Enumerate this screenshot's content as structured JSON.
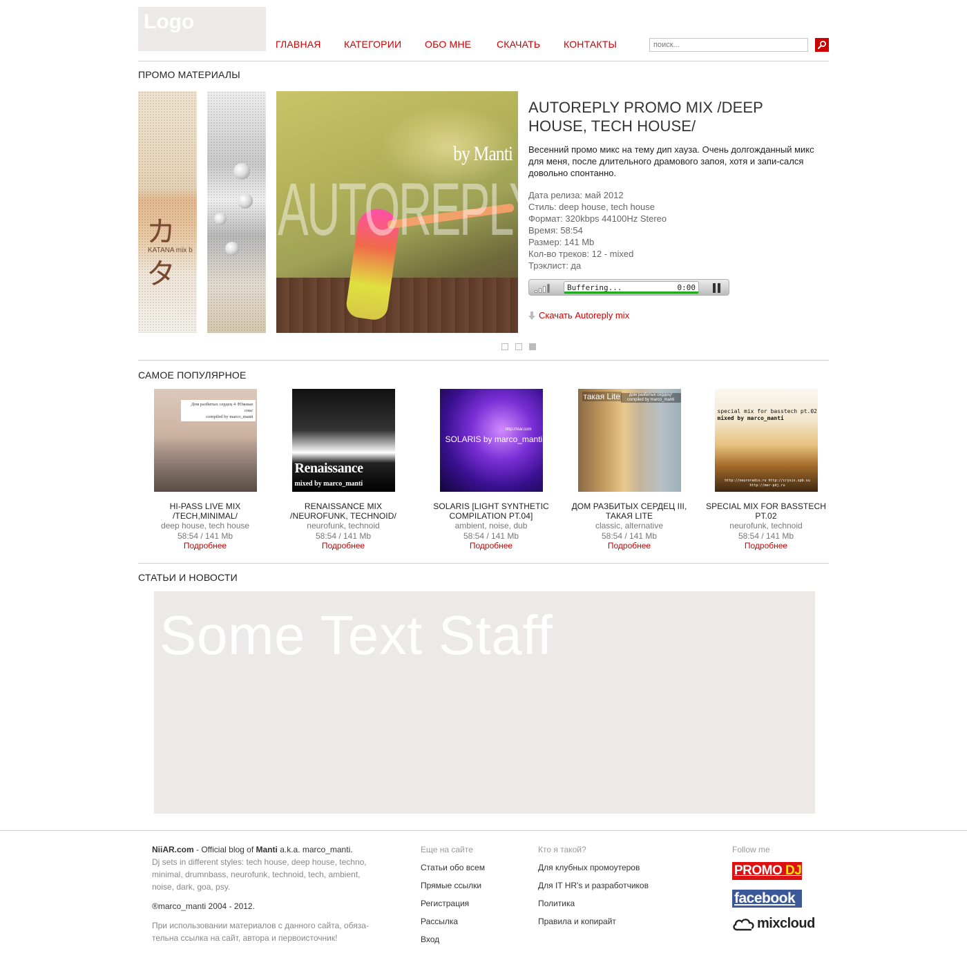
{
  "header": {
    "logo": "Logo",
    "nav": [
      "ГЛАВНАЯ",
      "КАТЕГОРИИ",
      "ОБО МНЕ",
      "СКАЧАТЬ",
      "КОНТАКТЫ"
    ],
    "search_placeholder": "поиск..."
  },
  "promo": {
    "section_title": "ПРОМО МАТЕРИАЛЫ",
    "strip1_kanji": "カタ",
    "strip1_caption": "KATANA mix b",
    "cover_byline": "by Manti",
    "cover_big": "AUTOREPLY",
    "title": "AUTOREPLY PROMO MIX /DEEP HOUSE, TECH HOUSE/",
    "description": "Весенний промо микс на тему дип хауза. Очень долгожданный микс для меня, после длительного драмового запоя, хотя и запи-сался довольно спонтанно.",
    "meta": [
      "Дата релиза: май 2012",
      "Стиль: deep house, tech house",
      "Формат: 320kbps 44100Hz Stereo",
      "Время: 58:54",
      "Размер: 141 Mb",
      "Кол-во треков: 12 - mixed",
      "Трэклист: да"
    ],
    "player": {
      "status": "Buffering...",
      "time": "0:00"
    },
    "download_label": "Скачать Autoreply mix",
    "pager_count": 3,
    "pager_active": 2
  },
  "popular": {
    "section_title": "САМОЕ ПОПУЛЯРНОЕ",
    "more_label": "Подробнее",
    "items": [
      {
        "name": "HI-PASS LIVE MIX /TECH,MINIMAL/",
        "genre": "deep house, tech house",
        "size": "58:54 / 141 Mb",
        "cover_text": [
          "Дом разбитых сердец 4 /Южные сны/",
          "compiled by marco_manti"
        ]
      },
      {
        "name": "RENAISSANCE MIX /NEUROFUNK, TECHNOID/",
        "genre": "neurofunk, technoid",
        "size": "58:54 / 141 Mb",
        "cover_text": [
          "Renaissance",
          "mixed by marco_manti"
        ]
      },
      {
        "name": "SOLARIS [LIGHT SYNTHETIC COMPILATION PT.04]",
        "genre": "ambient, noise, dub",
        "size": "58:54 / 141 Mb",
        "cover_text": [
          "SOLARIS by marco_manti",
          "http://niar.com"
        ]
      },
      {
        "name": "ДОМ РАЗБИТЫХ СЕРДЕЦ III, ТАКАЯ LITE",
        "genre": "classic, alternative",
        "size": "58:54 / 141 Mb",
        "cover_text": [
          "такая Lite",
          "дом разбитых сердец³ compiled by marco_manti"
        ]
      },
      {
        "name": "SPECIAL MIX FOR BASSTECH PT.02",
        "genre": "neurofunk, technoid",
        "size": "58:54 / 141 Mb",
        "cover_text": [
          "special mix for basstech pt.02",
          "mixed by marco_manti",
          "http://neuroradio.ru http://crysis.spb.su http://mer-pdj.ru"
        ]
      }
    ]
  },
  "articles": {
    "section_title": "СТАТЬИ И НОВОСТИ",
    "placeholder": "Some Text Staff"
  },
  "footer": {
    "site": "NiiAR.com",
    "tagline_1": " - Official blog of ",
    "author": "Manti",
    "tagline_2": " a.k.a. marco_manti.",
    "styles": "Dj sets in different styles: tech house, deep house, techno, minimal, drumnbass, neurofunk, technoid, tech, ambient, noise, dark, goa, psy.",
    "copyright": "®marco_manti 2004 - 2012.",
    "notice": "При использовании материалов с данного сайта, обяза-тельна ссылка на сайт, автора и первоисточник!",
    "col1": {
      "head": "Еще на сайте",
      "links": [
        "Статьи обо всем",
        "Прямые ссылки",
        "Регистрация",
        "Рассылка",
        "Вход"
      ]
    },
    "col2": {
      "head": "Кто я такой?",
      "links": [
        "Для клубных промоутеров",
        "Для IT HR's и разработчиков",
        "Политика",
        "Правила и копирайт"
      ]
    },
    "follow": {
      "head": "Follow me",
      "promo": "PROMO",
      "dj": " DJ",
      "facebook": "facebook",
      "mixcloud": "mixcloud"
    }
  },
  "colors": {
    "accent": "#cc0000",
    "placeholder_bg": "#ece9e8",
    "rule": "#cfcfcf"
  }
}
